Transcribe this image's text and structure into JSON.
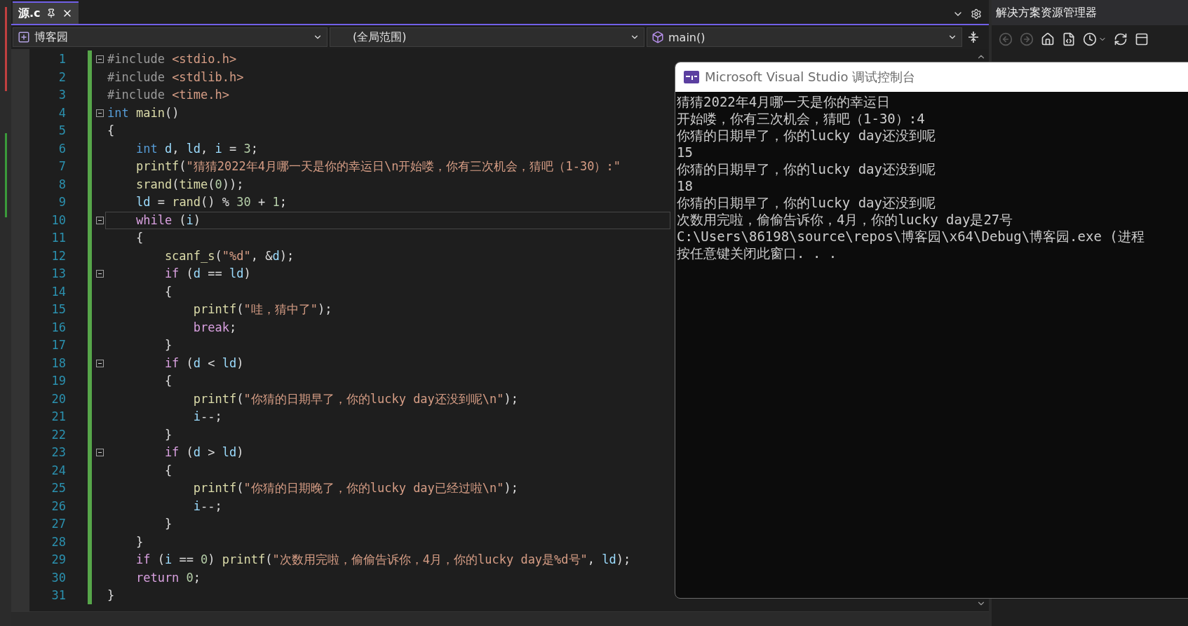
{
  "document_tab": {
    "label": "源.c",
    "selected": true
  },
  "navigation_bar": {
    "project": "博客园",
    "scope": "(全局范围)",
    "member": "main()"
  },
  "editor": {
    "lines": [
      {
        "number": "1",
        "fold": true,
        "current": false,
        "tokens": [
          {
            "kind": "pp",
            "text": "#include "
          },
          {
            "kind": "str",
            "text": "<stdio.h>"
          }
        ]
      },
      {
        "number": "2",
        "fold": false,
        "current": false,
        "tokens": [
          {
            "kind": "pp",
            "text": "#include "
          },
          {
            "kind": "str",
            "text": "<stdlib.h>"
          }
        ]
      },
      {
        "number": "3",
        "fold": false,
        "current": false,
        "tokens": [
          {
            "kind": "pp",
            "text": "#include "
          },
          {
            "kind": "str",
            "text": "<time.h>"
          }
        ]
      },
      {
        "number": "4",
        "fold": true,
        "current": false,
        "tokens": [
          {
            "kind": "kw",
            "text": "int "
          },
          {
            "kind": "fn",
            "text": "main"
          },
          {
            "kind": "txt",
            "text": "()"
          }
        ]
      },
      {
        "number": "5",
        "fold": false,
        "current": false,
        "tokens": [
          {
            "kind": "txt",
            "text": "{"
          }
        ]
      },
      {
        "number": "6",
        "fold": false,
        "current": false,
        "tokens": [
          {
            "kind": "kw",
            "text": "    int "
          },
          {
            "kind": "var",
            "text": "d"
          },
          {
            "kind": "txt",
            "text": ", "
          },
          {
            "kind": "var",
            "text": "ld"
          },
          {
            "kind": "txt",
            "text": ", "
          },
          {
            "kind": "var",
            "text": "i"
          },
          {
            "kind": "txt",
            "text": " = "
          },
          {
            "kind": "num",
            "text": "3"
          },
          {
            "kind": "txt",
            "text": ";"
          }
        ]
      },
      {
        "number": "7",
        "fold": false,
        "current": false,
        "tokens": [
          {
            "kind": "fn",
            "text": "    printf"
          },
          {
            "kind": "txt",
            "text": "("
          },
          {
            "kind": "str",
            "text": "\"猜猜2022年4月哪一天是你的幸运日\\n开始喽，你有三次机会，猜吧（1-30）:\""
          }
        ]
      },
      {
        "number": "8",
        "fold": false,
        "current": false,
        "tokens": [
          {
            "kind": "fn",
            "text": "    srand"
          },
          {
            "kind": "txt",
            "text": "("
          },
          {
            "kind": "fn",
            "text": "time"
          },
          {
            "kind": "txt",
            "text": "("
          },
          {
            "kind": "num",
            "text": "0"
          },
          {
            "kind": "txt",
            "text": "));"
          }
        ]
      },
      {
        "number": "9",
        "fold": false,
        "current": false,
        "tokens": [
          {
            "kind": "var",
            "text": "    ld"
          },
          {
            "kind": "txt",
            "text": " = "
          },
          {
            "kind": "fn",
            "text": "rand"
          },
          {
            "kind": "txt",
            "text": "() % "
          },
          {
            "kind": "num",
            "text": "30"
          },
          {
            "kind": "txt",
            "text": " + "
          },
          {
            "kind": "num",
            "text": "1"
          },
          {
            "kind": "txt",
            "text": ";"
          }
        ]
      },
      {
        "number": "10",
        "fold": true,
        "current": true,
        "tokens": [
          {
            "kind": "ctl",
            "text": "    while"
          },
          {
            "kind": "txt",
            "text": " ("
          },
          {
            "kind": "var",
            "text": "i"
          },
          {
            "kind": "txt",
            "text": ")"
          }
        ]
      },
      {
        "number": "11",
        "fold": false,
        "current": false,
        "tokens": [
          {
            "kind": "txt",
            "text": "    {"
          }
        ]
      },
      {
        "number": "12",
        "fold": false,
        "current": false,
        "tokens": [
          {
            "kind": "fn",
            "text": "        scanf_s"
          },
          {
            "kind": "txt",
            "text": "("
          },
          {
            "kind": "str",
            "text": "\"%d\""
          },
          {
            "kind": "txt",
            "text": ", &"
          },
          {
            "kind": "var",
            "text": "d"
          },
          {
            "kind": "txt",
            "text": ");"
          }
        ]
      },
      {
        "number": "13",
        "fold": true,
        "current": false,
        "tokens": [
          {
            "kind": "ctl",
            "text": "        if"
          },
          {
            "kind": "txt",
            "text": " ("
          },
          {
            "kind": "var",
            "text": "d"
          },
          {
            "kind": "txt",
            "text": " == "
          },
          {
            "kind": "var",
            "text": "ld"
          },
          {
            "kind": "txt",
            "text": ")"
          }
        ]
      },
      {
        "number": "14",
        "fold": false,
        "current": false,
        "tokens": [
          {
            "kind": "txt",
            "text": "        {"
          }
        ]
      },
      {
        "number": "15",
        "fold": false,
        "current": false,
        "tokens": [
          {
            "kind": "fn",
            "text": "            printf"
          },
          {
            "kind": "txt",
            "text": "("
          },
          {
            "kind": "str",
            "text": "\"哇，猜中了\""
          },
          {
            "kind": "txt",
            "text": ");"
          }
        ]
      },
      {
        "number": "16",
        "fold": false,
        "current": false,
        "tokens": [
          {
            "kind": "ctl",
            "text": "            break"
          },
          {
            "kind": "txt",
            "text": ";"
          }
        ]
      },
      {
        "number": "17",
        "fold": false,
        "current": false,
        "tokens": [
          {
            "kind": "txt",
            "text": "        }"
          }
        ]
      },
      {
        "number": "18",
        "fold": true,
        "current": false,
        "tokens": [
          {
            "kind": "ctl",
            "text": "        if"
          },
          {
            "kind": "txt",
            "text": " ("
          },
          {
            "kind": "var",
            "text": "d"
          },
          {
            "kind": "txt",
            "text": " < "
          },
          {
            "kind": "var",
            "text": "ld"
          },
          {
            "kind": "txt",
            "text": ")"
          }
        ]
      },
      {
        "number": "19",
        "fold": false,
        "current": false,
        "tokens": [
          {
            "kind": "txt",
            "text": "        {"
          }
        ]
      },
      {
        "number": "20",
        "fold": false,
        "current": false,
        "tokens": [
          {
            "kind": "fn",
            "text": "            printf"
          },
          {
            "kind": "txt",
            "text": "("
          },
          {
            "kind": "str",
            "text": "\"你猜的日期早了，你的lucky day还没到呢\\n\""
          },
          {
            "kind": "txt",
            "text": ");"
          }
        ]
      },
      {
        "number": "21",
        "fold": false,
        "current": false,
        "tokens": [
          {
            "kind": "var",
            "text": "            i"
          },
          {
            "kind": "txt",
            "text": "--;"
          }
        ]
      },
      {
        "number": "22",
        "fold": false,
        "current": false,
        "tokens": [
          {
            "kind": "txt",
            "text": "        }"
          }
        ]
      },
      {
        "number": "23",
        "fold": true,
        "current": false,
        "tokens": [
          {
            "kind": "ctl",
            "text": "        if"
          },
          {
            "kind": "txt",
            "text": " ("
          },
          {
            "kind": "var",
            "text": "d"
          },
          {
            "kind": "txt",
            "text": " > "
          },
          {
            "kind": "var",
            "text": "ld"
          },
          {
            "kind": "txt",
            "text": ")"
          }
        ]
      },
      {
        "number": "24",
        "fold": false,
        "current": false,
        "tokens": [
          {
            "kind": "txt",
            "text": "        {"
          }
        ]
      },
      {
        "number": "25",
        "fold": false,
        "current": false,
        "tokens": [
          {
            "kind": "fn",
            "text": "            printf"
          },
          {
            "kind": "txt",
            "text": "("
          },
          {
            "kind": "str",
            "text": "\"你猜的日期晚了，你的lucky day已经过啦\\n\""
          },
          {
            "kind": "txt",
            "text": ");"
          }
        ]
      },
      {
        "number": "26",
        "fold": false,
        "current": false,
        "tokens": [
          {
            "kind": "var",
            "text": "            i"
          },
          {
            "kind": "txt",
            "text": "--;"
          }
        ]
      },
      {
        "number": "27",
        "fold": false,
        "current": false,
        "tokens": [
          {
            "kind": "txt",
            "text": "        }"
          }
        ]
      },
      {
        "number": "28",
        "fold": false,
        "current": false,
        "tokens": [
          {
            "kind": "txt",
            "text": "    }"
          }
        ]
      },
      {
        "number": "29",
        "fold": false,
        "current": false,
        "tokens": [
          {
            "kind": "ctl",
            "text": "    if"
          },
          {
            "kind": "txt",
            "text": " ("
          },
          {
            "kind": "var",
            "text": "i"
          },
          {
            "kind": "txt",
            "text": " == "
          },
          {
            "kind": "num",
            "text": "0"
          },
          {
            "kind": "txt",
            "text": ") "
          },
          {
            "kind": "fn",
            "text": "printf"
          },
          {
            "kind": "txt",
            "text": "("
          },
          {
            "kind": "str",
            "text": "\"次数用完啦，偷偷告诉你，4月，你的lucky day是%d号\""
          },
          {
            "kind": "txt",
            "text": ", "
          },
          {
            "kind": "var",
            "text": "ld"
          },
          {
            "kind": "txt",
            "text": ");"
          }
        ]
      },
      {
        "number": "30",
        "fold": false,
        "current": false,
        "tokens": [
          {
            "kind": "ctl",
            "text": "    return "
          },
          {
            "kind": "num",
            "text": "0"
          },
          {
            "kind": "txt",
            "text": ";"
          }
        ]
      },
      {
        "number": "31",
        "fold": false,
        "current": false,
        "tokens": [
          {
            "kind": "txt",
            "text": "}"
          }
        ]
      }
    ]
  },
  "solution_explorer": {
    "title": "解决方案资源管理器",
    "toolbar": [
      {
        "kind": "back",
        "disabled": true
      },
      {
        "kind": "forward",
        "disabled": true
      },
      {
        "kind": "home",
        "disabled": false
      },
      {
        "kind": "switch",
        "disabled": false
      },
      {
        "kind": "history",
        "disabled": false
      },
      {
        "kind": "refresh",
        "disabled": false
      },
      {
        "kind": "collapse",
        "disabled": false
      }
    ]
  },
  "console": {
    "title": "Microsoft Visual Studio 调试控制台",
    "lines": [
      "猜猜2022年4月哪一天是你的幸运日",
      "开始喽，你有三次机会，猜吧（1-30）:4",
      "你猜的日期早了，你的lucky day还没到呢",
      "15",
      "你猜的日期早了，你的lucky day还没到呢",
      "18",
      "你猜的日期早了，你的lucky day还没到呢",
      "次数用完啦，偷偷告诉你，4月，你的lucky day是27号",
      "C:\\Users\\86198\\source\\repos\\博客园\\x64\\Debug\\博客园.exe (进程",
      "按任意键关闭此窗口. . ."
    ]
  }
}
